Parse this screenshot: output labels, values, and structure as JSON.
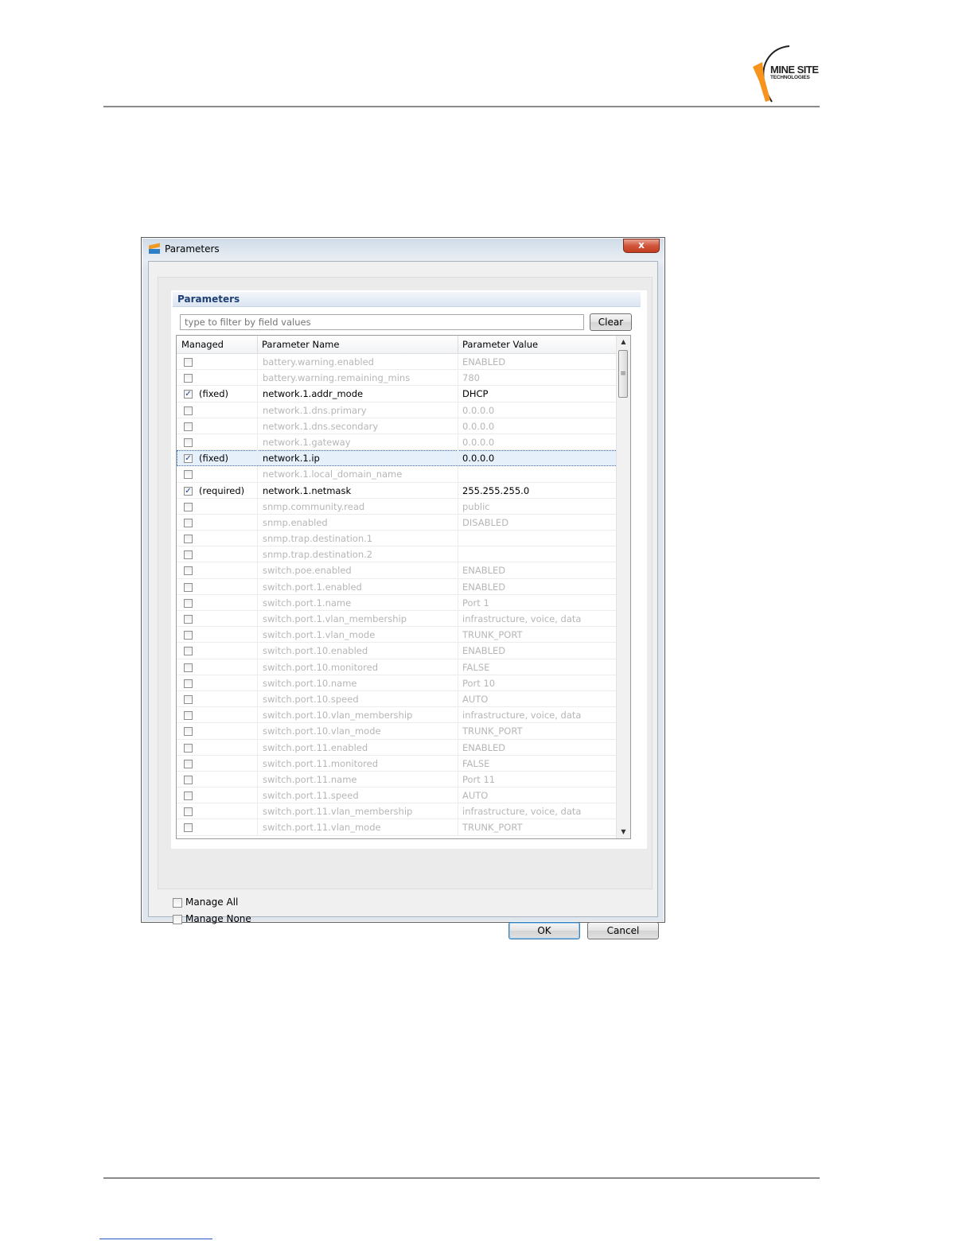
{
  "page": {
    "logo": {
      "line1": "MINE SITE",
      "line2": "TECHNOLOGIES",
      "icon": "mine-site-logo"
    }
  },
  "dialog": {
    "title": "Parameters",
    "close_label": "x",
    "section_title": "Parameters",
    "filter_placeholder": "type to filter by field values",
    "clear_label": "Clear",
    "columns": [
      "Managed",
      "Parameter Name",
      "Parameter Value"
    ],
    "rows": [
      {
        "checked": false,
        "status": "",
        "name": "battery.warning.enabled",
        "value": "ENABLED"
      },
      {
        "checked": false,
        "status": "",
        "name": "battery.warning.remaining_mins",
        "value": "780"
      },
      {
        "checked": true,
        "status": "(fixed)",
        "name": "network.1.addr_mode",
        "value": "DHCP"
      },
      {
        "checked": false,
        "status": "",
        "name": "network.1.dns.primary",
        "value": "0.0.0.0"
      },
      {
        "checked": false,
        "status": "",
        "name": "network.1.dns.secondary",
        "value": "0.0.0.0"
      },
      {
        "checked": false,
        "status": "",
        "name": "network.1.gateway",
        "value": "0.0.0.0"
      },
      {
        "checked": true,
        "status": "(fixed)",
        "name": "network.1.ip",
        "value": "0.0.0.0",
        "selected": true
      },
      {
        "checked": false,
        "status": "",
        "name": "network.1.local_domain_name",
        "value": ""
      },
      {
        "checked": true,
        "status": "(required)",
        "name": "network.1.netmask",
        "value": "255.255.255.0"
      },
      {
        "checked": false,
        "status": "",
        "name": "snmp.community.read",
        "value": "public"
      },
      {
        "checked": false,
        "status": "",
        "name": "snmp.enabled",
        "value": "DISABLED"
      },
      {
        "checked": false,
        "status": "",
        "name": "snmp.trap.destination.1",
        "value": ""
      },
      {
        "checked": false,
        "status": "",
        "name": "snmp.trap.destination.2",
        "value": ""
      },
      {
        "checked": false,
        "status": "",
        "name": "switch.poe.enabled",
        "value": "ENABLED"
      },
      {
        "checked": false,
        "status": "",
        "name": "switch.port.1.enabled",
        "value": "ENABLED"
      },
      {
        "checked": false,
        "status": "",
        "name": "switch.port.1.name",
        "value": "Port 1"
      },
      {
        "checked": false,
        "status": "",
        "name": "switch.port.1.vlan_membership",
        "value": "infrastructure, voice, data"
      },
      {
        "checked": false,
        "status": "",
        "name": "switch.port.1.vlan_mode",
        "value": "TRUNK_PORT"
      },
      {
        "checked": false,
        "status": "",
        "name": "switch.port.10.enabled",
        "value": "ENABLED"
      },
      {
        "checked": false,
        "status": "",
        "name": "switch.port.10.monitored",
        "value": "FALSE"
      },
      {
        "checked": false,
        "status": "",
        "name": "switch.port.10.name",
        "value": "Port 10"
      },
      {
        "checked": false,
        "status": "",
        "name": "switch.port.10.speed",
        "value": "AUTO"
      },
      {
        "checked": false,
        "status": "",
        "name": "switch.port.10.vlan_membership",
        "value": "infrastructure, voice, data"
      },
      {
        "checked": false,
        "status": "",
        "name": "switch.port.10.vlan_mode",
        "value": "TRUNK_PORT"
      },
      {
        "checked": false,
        "status": "",
        "name": "switch.port.11.enabled",
        "value": "ENABLED"
      },
      {
        "checked": false,
        "status": "",
        "name": "switch.port.11.monitored",
        "value": "FALSE"
      },
      {
        "checked": false,
        "status": "",
        "name": "switch.port.11.name",
        "value": "Port 11"
      },
      {
        "checked": false,
        "status": "",
        "name": "switch.port.11.speed",
        "value": "AUTO"
      },
      {
        "checked": false,
        "status": "",
        "name": "switch.port.11.vlan_membership",
        "value": "infrastructure, voice, data"
      },
      {
        "checked": false,
        "status": "",
        "name": "switch.port.11.vlan_mode",
        "value": "TRUNK_PORT"
      }
    ],
    "manage_all_label": "Manage All",
    "manage_none_label": "Manage None",
    "ok_label": "OK",
    "cancel_label": "Cancel",
    "colors": {
      "disabled_text": "#b6b6b6",
      "header_text": "#1d3f75",
      "accent": "#f7941d"
    }
  }
}
